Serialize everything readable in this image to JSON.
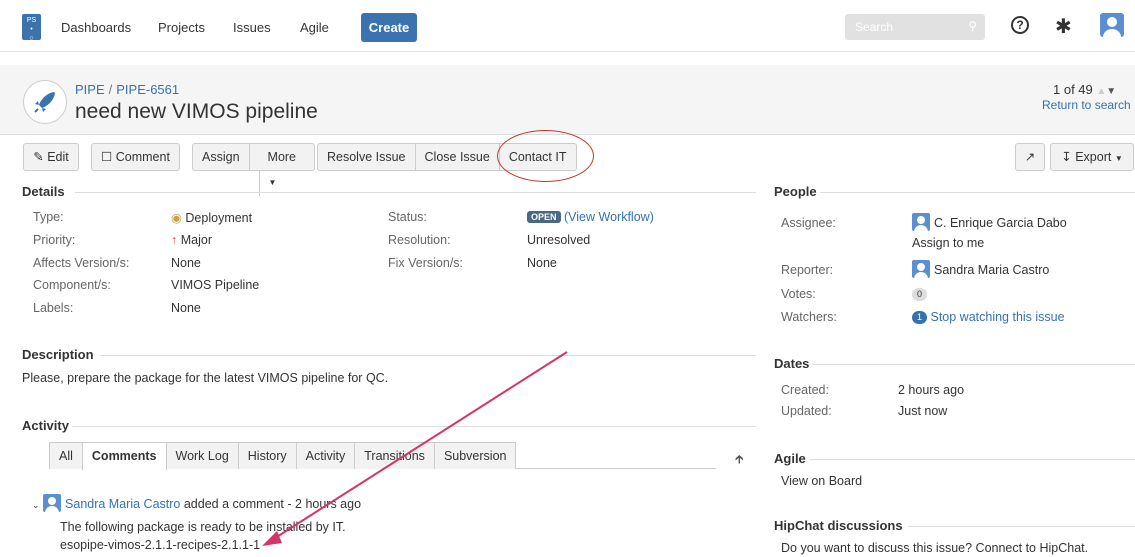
{
  "nav": {
    "logo_text": "PS",
    "items": [
      "Dashboards",
      "Projects",
      "Issues",
      "Agile"
    ],
    "create_label": "Create",
    "search_placeholder": "Search"
  },
  "header": {
    "project": "PIPE",
    "issue_key": "PIPE-6561",
    "title": "need new VIMOS pipeline",
    "pager": "1 of 49",
    "return_label": "Return to search"
  },
  "toolbar": {
    "edit": "Edit",
    "comment": "Comment",
    "assign": "Assign",
    "more": "More",
    "resolve": "Resolve Issue",
    "close": "Close Issue",
    "contact": "Contact IT",
    "export": "Export"
  },
  "details": {
    "title": "Details",
    "type_label": "Type:",
    "type_value": "Deployment",
    "priority_label": "Priority:",
    "priority_value": "Major",
    "affects_label": "Affects Version/s:",
    "affects_value": "None",
    "component_label": "Component/s:",
    "component_value": "VIMOS Pipeline",
    "labels_label": "Labels:",
    "labels_value": "None",
    "status_label": "Status:",
    "status_value": "OPEN",
    "workflow_link": "View Workflow",
    "resolution_label": "Resolution:",
    "resolution_value": "Unresolved",
    "fix_label": "Fix Version/s:",
    "fix_value": "None"
  },
  "description": {
    "title": "Description",
    "text": "Please, prepare the package for the latest VIMOS pipeline for QC."
  },
  "activity": {
    "title": "Activity",
    "tabs": [
      "All",
      "Comments",
      "Work Log",
      "History",
      "Activity",
      "Transitions",
      "Subversion"
    ],
    "active_tab": "Comments",
    "comment_author": "Sandra Maria Castro",
    "comment_meta": "added a comment - 2 hours ago",
    "comment_line1": "The following package is ready to be installed by IT.",
    "comment_line2": "esopipe-vimos-2.1.1-recipes-2.1.1-1"
  },
  "people": {
    "title": "People",
    "assignee_label": "Assignee:",
    "assignee_value": "C. Enrique Garcia Dabo",
    "assign_to_me": "Assign to me",
    "reporter_label": "Reporter:",
    "reporter_value": "Sandra Maria Castro",
    "votes_label": "Votes:",
    "votes_value": "0",
    "watchers_label": "Watchers:",
    "watchers_count": "1",
    "watchers_link": "Stop watching this issue"
  },
  "dates": {
    "title": "Dates",
    "created_label": "Created:",
    "created_value": "2 hours ago",
    "updated_label": "Updated:",
    "updated_value": "Just now"
  },
  "agile": {
    "title": "Agile",
    "link": "View on Board"
  },
  "hipchat": {
    "title": "HipChat discussions",
    "text": "Do you want to discuss this issue? Connect to HipChat."
  },
  "colors": {
    "accent": "#3b73af",
    "link": "#3572b0",
    "annotation": "#d6336c",
    "ring": "#c0392b"
  }
}
